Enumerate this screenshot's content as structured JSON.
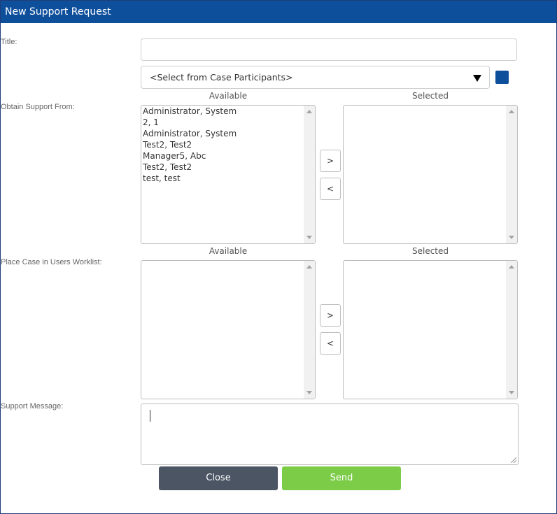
{
  "dialog": {
    "title": "New Support Request"
  },
  "form": {
    "title_label": "Title:",
    "title_value": "",
    "participants_select": "<Select from Case Participants>",
    "obtain_label": "Obtain Support From:",
    "worklist_label": "Place Case in Users Worklist:",
    "message_label": "Support Message:",
    "message_value": ""
  },
  "obtain": {
    "available_header": "Available",
    "selected_header": "Selected",
    "available_items": [
      "Administrator, System",
      "2, 1",
      "Administrator, System",
      "Test2, Test2",
      "Manager5, Abc",
      "Test2, Test2",
      "test, test"
    ],
    "selected_items": [],
    "move_right": ">",
    "move_left": "<"
  },
  "worklist": {
    "available_header": "Available",
    "selected_header": "Selected",
    "available_items": [],
    "selected_items": [],
    "move_right": ">",
    "move_left": "<"
  },
  "buttons": {
    "close": "Close",
    "send": "Send"
  },
  "colors": {
    "titlebar": "#0e4f9c",
    "swatch": "#0e4f9c",
    "close_button": "#4b5563",
    "send_button": "#7ccc48"
  },
  "icons": {
    "dropdown": "caret-down-icon",
    "scroll_up": "scroll-up-arrow-icon",
    "scroll_down": "scroll-down-arrow-icon",
    "resize": "resize-grip-icon"
  }
}
